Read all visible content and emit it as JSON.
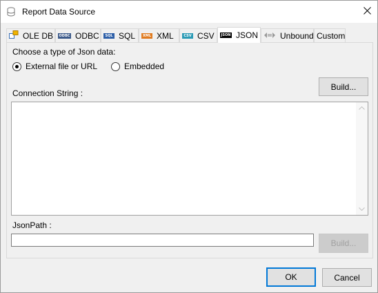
{
  "window": {
    "title": "Report Data Source",
    "icon": "database-icon"
  },
  "tabs": [
    {
      "label": "OLE DB",
      "icon": "oledb-icon"
    },
    {
      "label": "ODBC",
      "icon": "odbc-icon",
      "badge": "ODBC"
    },
    {
      "label": "SQL",
      "icon": "sql-icon",
      "badge": "SQL"
    },
    {
      "label": "XML",
      "icon": "xml-icon",
      "badge": "XML"
    },
    {
      "label": "CSV",
      "icon": "csv-icon",
      "badge": "CSV"
    },
    {
      "label": "JSON",
      "icon": "json-icon",
      "badge": "JSON",
      "active": true
    },
    {
      "label": "Unbound",
      "icon": "unbound-icon"
    },
    {
      "label": "Custom"
    }
  ],
  "json_panel": {
    "type_label": "Choose a type of Json data:",
    "options": [
      {
        "label": "External file or URL",
        "checked": true
      },
      {
        "label": "Embedded",
        "checked": false
      }
    ],
    "connection_label": "Connection String :",
    "connection_value": "",
    "build_label": "Build...",
    "jsonpath_label": "JsonPath :",
    "jsonpath_value": "",
    "build2_label": "Build..."
  },
  "footer": {
    "ok_label": "OK",
    "cancel_label": "Cancel"
  },
  "colors": {
    "accent": "#0078d7"
  }
}
